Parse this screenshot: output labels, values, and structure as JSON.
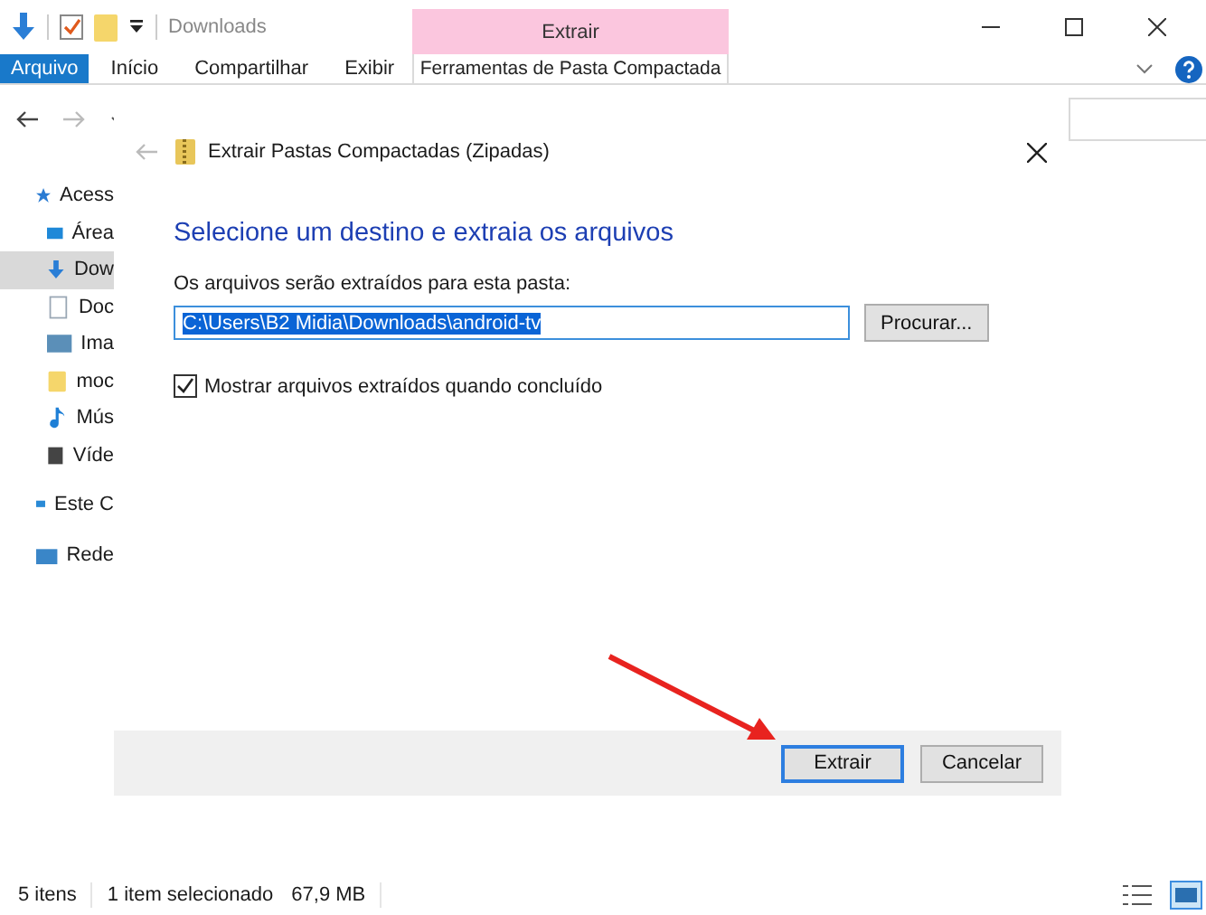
{
  "title_bar": {
    "location": "Downloads",
    "context_group": "Extrair"
  },
  "ribbon_tabs": [
    {
      "label": "Arquivo",
      "kind": "file",
      "selected": false
    },
    {
      "label": "Início",
      "kind": "tab",
      "selected": false
    },
    {
      "label": "Compartilhar",
      "kind": "tab",
      "selected": false
    },
    {
      "label": "Exibir",
      "kind": "tab",
      "selected": false
    },
    {
      "label": "Ferramentas de Pasta Compactada",
      "kind": "context",
      "selected": true
    }
  ],
  "nav_pane": [
    {
      "label": "Acess",
      "kind": "star",
      "selected": false,
      "children": [
        {
          "label": "Área",
          "kind": "desktop",
          "selected": false
        },
        {
          "label": "Dow",
          "kind": "download",
          "selected": true
        },
        {
          "label": "Doc",
          "kind": "document",
          "selected": false
        },
        {
          "label": "Ima",
          "kind": "image",
          "selected": false
        },
        {
          "label": "moc",
          "kind": "folder",
          "selected": false
        },
        {
          "label": "Mús",
          "kind": "music",
          "selected": false
        },
        {
          "label": "Víde",
          "kind": "video",
          "selected": false
        }
      ]
    },
    {
      "label": "Este C",
      "kind": "pc",
      "selected": false
    },
    {
      "label": "Rede",
      "kind": "network",
      "selected": false
    }
  ],
  "dialog": {
    "title": "Extrair Pastas Compactadas (Zipadas)",
    "heading": "Selecione um destino e extraia os arquivos",
    "field_label": "Os arquivos serão extraídos para esta pasta:",
    "path": "C:\\Users\\B2 Midia\\Downloads\\android-tv",
    "path_highlighted": true,
    "browse_button": "Procurar...",
    "show_files": {
      "label": "Mostrar arquivos extraídos quando concluído",
      "checked": true
    },
    "buttons": [
      {
        "label": "Extrair",
        "default": true
      },
      {
        "label": "Cancelar",
        "default": false
      }
    ]
  },
  "status_bar": {
    "item_count": "5 itens",
    "selection": "1 item selecionado",
    "size": "67,9 MB"
  }
}
